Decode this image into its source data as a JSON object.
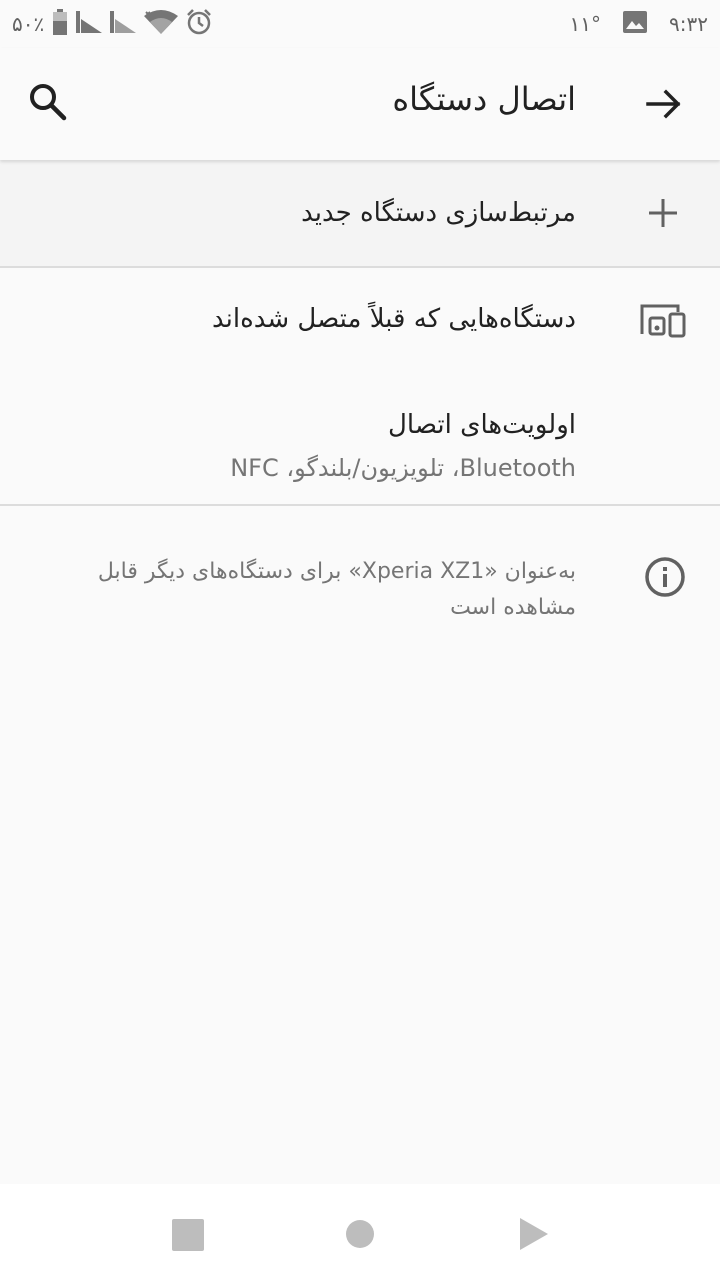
{
  "status_bar": {
    "battery_text": "۵۰٪",
    "time": "۹:۳۲",
    "temperature": "۱۱°",
    "icons": [
      "battery-icon",
      "signal-icon",
      "signal-icon",
      "wifi-icon",
      "alarm-icon",
      "image-icon"
    ]
  },
  "toolbar": {
    "title": "اتصال دستگاه",
    "back_icon": "arrow-forward-icon",
    "search_icon": "search-icon"
  },
  "pair_new": {
    "label": "مرتبط‌سازی دستگاه جدید",
    "icon": "plus-icon"
  },
  "previously_connected": {
    "label": "دستگاه‌هایی که قبلاً متصل شده‌اند",
    "icon": "devices-icon"
  },
  "connection_preferences": {
    "title": "اولویت‌های اتصال",
    "summary": "Bluetooth، تلویزیون/بلندگو، NFC"
  },
  "info": {
    "text": "به‌عنوان «Xperia XZ1» برای دستگاه‌های دیگر قابل مشاهده است",
    "icon": "info-icon"
  },
  "colors": {
    "background": "#fafafa",
    "section_background": "#f4f4f4",
    "primary_text": "#212121",
    "secondary_text": "#757575",
    "icon": "#616161"
  }
}
